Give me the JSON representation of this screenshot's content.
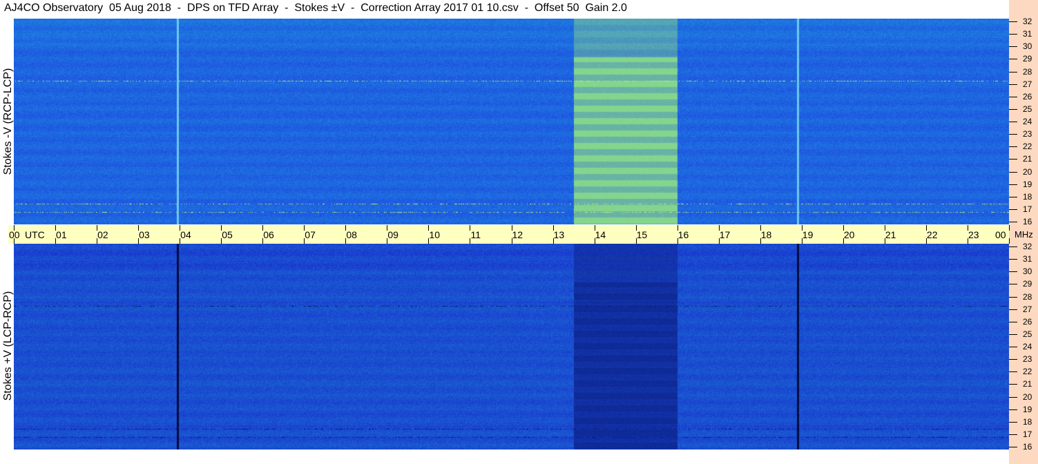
{
  "title": "AJ4CO Observatory  05 Aug 2018  -  DPS on TFD Array  -  Stokes ±V  -  Correction Array 2017 01 10.csv  -  Offset 50  Gain 2.0",
  "chart_data": {
    "type": "heatmap",
    "title": "AJ4CO Observatory  05 Aug 2018  -  DPS on TFD Array  -  Stokes ±V  -  Correction Array 2017 01 10.csv  -  Offset 50  Gain 2.0",
    "x_axis": {
      "ticks": [
        "00",
        "01",
        "02",
        "03",
        "04",
        "05",
        "06",
        "07",
        "08",
        "09",
        "10",
        "11",
        "12",
        "13",
        "14",
        "15",
        "16",
        "17",
        "18",
        "19",
        "20",
        "21",
        "22",
        "23",
        "00"
      ],
      "unit_label": "UTC",
      "range": [
        0,
        24
      ]
    },
    "y_axis": {
      "ticks": [
        "32",
        "31",
        "30",
        "29",
        "28",
        "27",
        "26",
        "25",
        "24",
        "23",
        "22",
        "21",
        "20",
        "19",
        "18",
        "17",
        "16"
      ],
      "unit_label": "MHz",
      "range": [
        16,
        32
      ]
    },
    "panels": [
      {
        "name": "Stokes -V (RCP-LCP)",
        "baseline": "#1e64e0",
        "bright_band_hours": [
          13.5,
          16.0
        ],
        "band_color": "#9ef07a"
      },
      {
        "name": "Stokes +V (LCP-RCP)",
        "baseline": "#1a4fd0",
        "dark_band_hours": [
          13.5,
          16.0
        ],
        "band_color": "#0a1a80"
      }
    ],
    "vertical_lines_hours": [
      3.95,
      18.9
    ]
  }
}
